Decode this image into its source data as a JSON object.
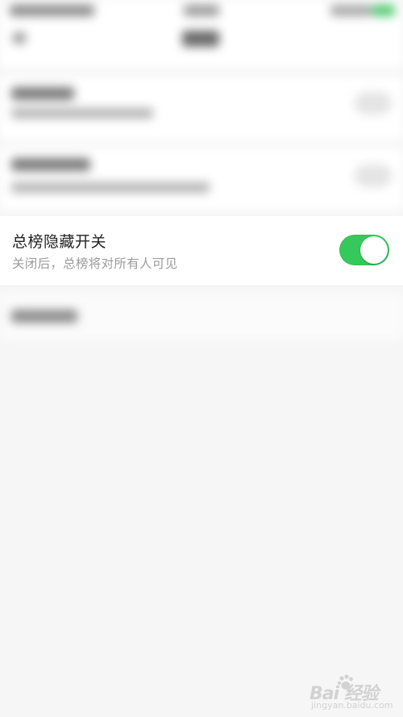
{
  "setting": {
    "title": "总榜隐藏开关",
    "subtitle": "关闭后，总榜将对所有人可见",
    "enabled": true
  },
  "colors": {
    "toggle_on": "#35c85a",
    "background": "#f6f6f6",
    "card": "#ffffff",
    "title_text": "#222222",
    "subtitle_text": "#9b9b9b"
  },
  "watermark": {
    "brand": "Bai  经验",
    "url": "jingyan.baidu.com",
    "icon": "paw-icon"
  }
}
